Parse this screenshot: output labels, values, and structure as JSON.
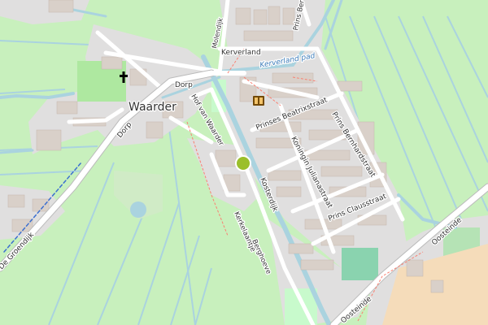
{
  "map": {
    "place_label": "Waarder",
    "streets": {
      "dorp_west": "Dorp",
      "dorp_north": "Dorp",
      "molendijk": "Molendijk",
      "hof_van_waarder": "Hof van Waarder",
      "kerverland": "Kerverland",
      "kerverland_pad": "Kerverland pad",
      "prinses_beatrixstraat": "Prinses Beatrixstraat",
      "prins_bernhardstraat": "Prins Bernhardstraat",
      "koningin_julianastraat": "Koningin Julianastraat",
      "prins_clausstraat": "Prins Clausstraat",
      "kosterdijk": "Kosterdijk",
      "kerkelaantje": "Kerkelaantje",
      "berghoeve": "Berghoeve",
      "de_groendijk": "De Groendijk",
      "oosteinde_south": "Oosteinde",
      "oosteinde_north": "Oosteinde",
      "prins_ber_top": "Prins Ber"
    },
    "icons": [
      "church-icon",
      "library-icon",
      "playground-icon"
    ],
    "colors": {
      "grass": "#c8f0bd",
      "residential": "#e0dfdf",
      "road": "#ffffff",
      "water": "#aad3df",
      "building": "#d9d0c9",
      "park": "#c8facc",
      "primary_road": "#fcd6a4"
    }
  }
}
